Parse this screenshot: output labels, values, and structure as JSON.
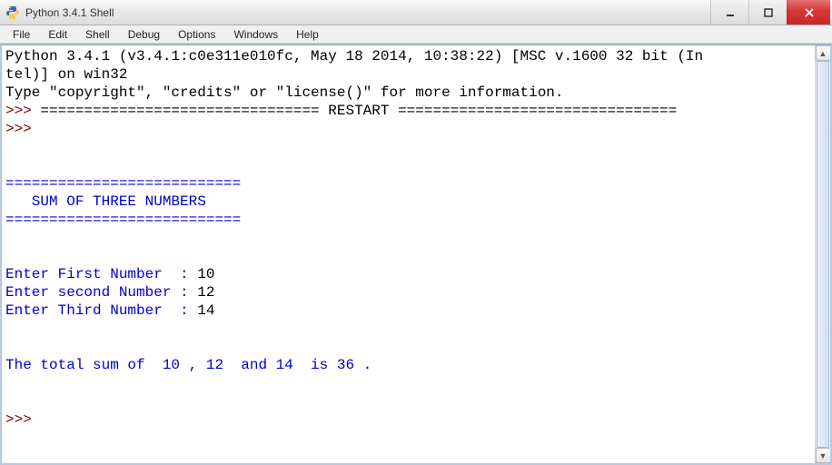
{
  "window": {
    "title": "Python 3.4.1 Shell"
  },
  "menu": {
    "items": [
      "File",
      "Edit",
      "Shell",
      "Debug",
      "Options",
      "Windows",
      "Help"
    ]
  },
  "console": {
    "l1": "Python 3.4.1 (v3.4.1:c0e311e010fc, May 18 2014, 10:38:22) [MSC v.1600 32 bit (In",
    "l2": "tel)] on win32",
    "l3": "Type \"copyright\", \"credits\" or \"license()\" for more information.",
    "prompt": ">>> ",
    "restart": "================================ RESTART ================================",
    "sep": "===========================",
    "heading": "   SUM OF THREE NUMBERS",
    "p1": "Enter First Number  : ",
    "v1": "10",
    "p2": "Enter second Number : ",
    "v2": "12",
    "p3": "Enter Third Number  : ",
    "v3": "14",
    "result": "The total sum of  10 , 12  and 14  is 36 ."
  }
}
